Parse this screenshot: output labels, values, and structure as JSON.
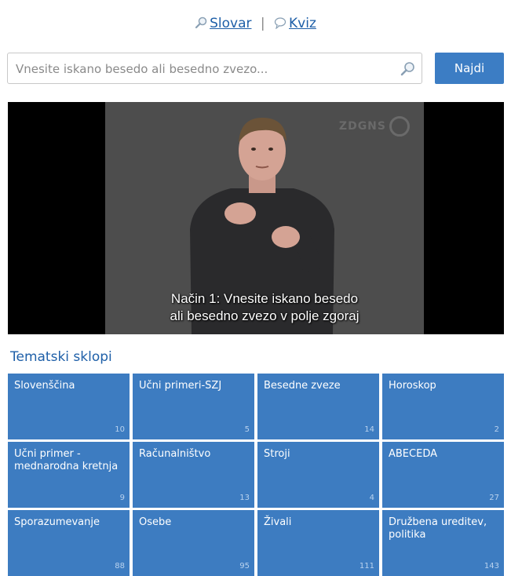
{
  "nav": {
    "dictionary_label": "Slovar",
    "separator": "|",
    "quiz_label": "Kviz"
  },
  "search": {
    "placeholder": "Vnesite iskano besedo ali besedno zvezo...",
    "value": "",
    "button_label": "Najdi"
  },
  "video": {
    "watermark": "ZDGNS",
    "subtitle_line1": "Način 1:  Vnesite iskano besedo",
    "subtitle_line2": "ali besedno zvezo v polje zgoraj"
  },
  "topics": {
    "title": "Tematski sklopi",
    "items": [
      {
        "label": "Slovenščina",
        "count": "10"
      },
      {
        "label": "Učni primeri-SZJ",
        "count": "5"
      },
      {
        "label": "Besedne zveze",
        "count": "14"
      },
      {
        "label": "Horoskop",
        "count": "2"
      },
      {
        "label": "Učni primer - mednarodna kretnja",
        "count": "9"
      },
      {
        "label": "Računalništvo",
        "count": "13"
      },
      {
        "label": "Stroji",
        "count": "4"
      },
      {
        "label": "ABECEDA",
        "count": "27"
      },
      {
        "label": "Sporazumevanje",
        "count": "88"
      },
      {
        "label": "Osebe",
        "count": "95"
      },
      {
        "label": "Živali",
        "count": "111"
      },
      {
        "label": "Družbena ureditev, politika",
        "count": "143"
      }
    ]
  },
  "colors": {
    "accent": "#3d7cc1",
    "link": "#1e5fa8"
  }
}
